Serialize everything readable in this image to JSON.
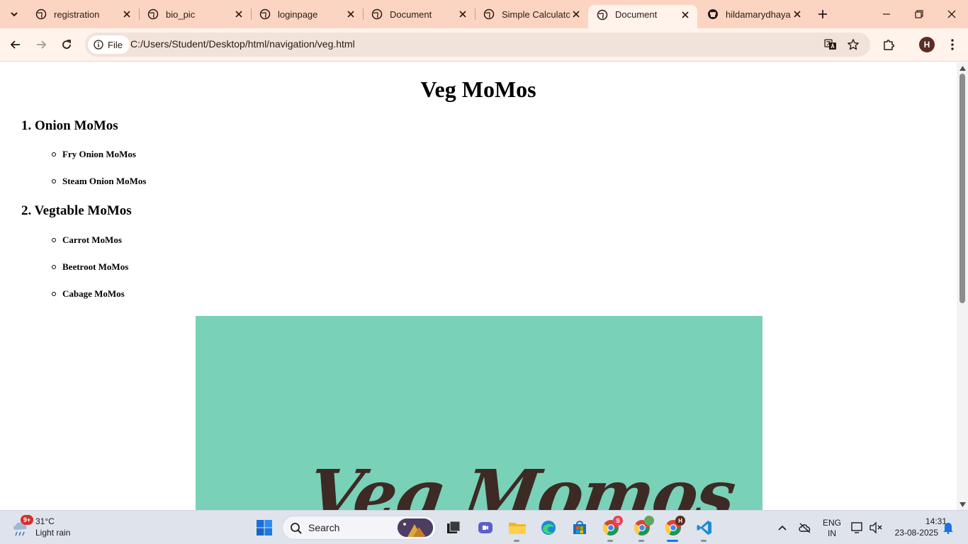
{
  "browser": {
    "tabs": [
      {
        "title": "registration",
        "icon": "globe-icon"
      },
      {
        "title": "bio_pic",
        "icon": "globe-icon"
      },
      {
        "title": "loginpage",
        "icon": "globe-icon"
      },
      {
        "title": "Document",
        "icon": "globe-icon"
      },
      {
        "title": "Simple Calculato",
        "icon": "globe-icon"
      },
      {
        "title": "Document",
        "icon": "globe-icon",
        "active": true
      },
      {
        "title": "hildamarydhayal",
        "icon": "github-icon"
      }
    ],
    "toolbar": {
      "site_info_label": "File",
      "url": "C:/Users/Student/Desktop/html/navigation/veg.html",
      "profile_initial": "H"
    }
  },
  "page": {
    "title": "Veg MoMos",
    "sections": [
      {
        "heading": "1. Onion MoMos",
        "items": [
          "Fry Onion MoMos",
          "Steam Onion MoMos"
        ]
      },
      {
        "heading": "2. Vegtable MoMos",
        "items": [
          "Carrot MoMos",
          "Beetroot MoMos",
          "Cabage MoMos"
        ]
      }
    ],
    "banner": {
      "text": "Veg Momos",
      "background": "#79d1b7",
      "text_color": "#3d2a24"
    }
  },
  "taskbar": {
    "weather": {
      "badge": "9+",
      "temp": "31°C",
      "condition": "Light rain"
    },
    "search_label": "Search",
    "tray": {
      "lang_line1": "ENG",
      "lang_line2": "IN",
      "time": "14:31",
      "date": "23-08-2025"
    },
    "chrome_profile_badges": {
      "s": "S",
      "h": "H"
    }
  },
  "colors": {
    "tabstrip": "#fcd5c2",
    "toolbar": "#fff3ec",
    "taskbar": "#dfe4ec",
    "accent": "#1a73e8"
  }
}
